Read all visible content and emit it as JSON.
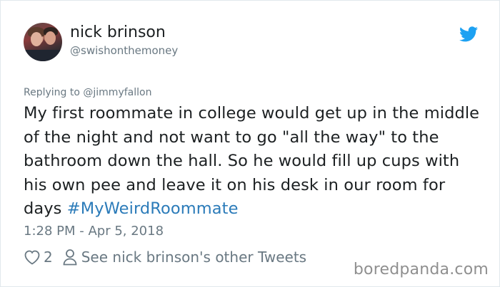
{
  "tweet": {
    "author_name": "nick brinson",
    "author_handle": "@swishonthemoney",
    "replying_prefix": "Replying to ",
    "replying_to": "@jimmyfallon",
    "text": "My first roommate in college would get up in the middle of the night and not want to go \"all the way\" to the bathroom down the hall. So he would fill up cups with his own pee and leave it on his desk in our room for days ",
    "hashtag": "#MyWeirdRoommate",
    "timestamp": "1:28 PM - Apr 5, 2018",
    "likes": "2",
    "other_tweets_label": "See nick brinson's other Tweets"
  },
  "watermark": "boredpanda.com",
  "icons": {
    "brand": "twitter-bird-icon",
    "like": "heart-icon",
    "profile": "user-icon"
  },
  "colors": {
    "brand_blue": "#1da1f2",
    "hashtag_blue": "#2b7bb9",
    "secondary_text": "#697882",
    "primary_text": "#1c2022",
    "border": "#e1e8ed"
  }
}
